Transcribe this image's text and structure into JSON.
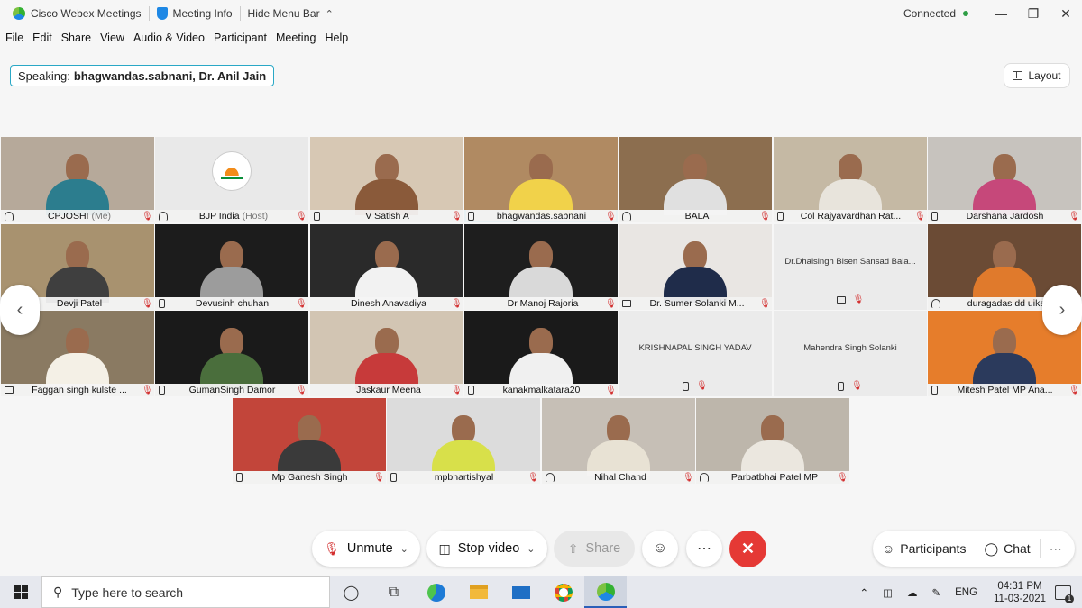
{
  "titlebar": {
    "app_name": "Cisco Webex Meetings",
    "meeting_info": "Meeting Info",
    "hide_menu": "Hide Menu Bar",
    "status": "Connected"
  },
  "menu": [
    "File",
    "Edit",
    "Share",
    "View",
    "Audio & Video",
    "Participant",
    "Meeting",
    "Help"
  ],
  "speaking": {
    "label": "Speaking:",
    "names": "bhagwandas.sabnani, Dr. Anil Jain"
  },
  "layout_label": "Layout",
  "tiles": [
    {
      "name": "CPJOSHI",
      "suffix": "(Me)",
      "device": "audio",
      "bg": "#b6a99a",
      "shirt": "#2c7d8e"
    },
    {
      "name": "BJP India",
      "suffix": "(Host)",
      "device": "audio",
      "bg": "#e9e9e9",
      "logo": true
    },
    {
      "name": "V Satish A",
      "suffix": "",
      "device": "phone",
      "bg": "#d7c8b4",
      "shirt": "#8a5a3a"
    },
    {
      "name": "bhagwandas.sabnani",
      "suffix": "",
      "device": "phone",
      "bg": "#b08a62",
      "shirt": "#f1d24a"
    },
    {
      "name": "BALA",
      "suffix": "",
      "device": "audio",
      "bg": "#8c6e4f",
      "shirt": "#e0e0e0"
    },
    {
      "name": "Col Rajyavardhan Rat...",
      "suffix": "",
      "device": "phone",
      "bg": "#c5b9a4",
      "shirt": "#e8e4dc"
    },
    {
      "name": "Darshana Jardosh",
      "suffix": "",
      "device": "phone",
      "bg": "#c7c3be",
      "shirt": "#c6487a"
    },
    {
      "name": "Devji Patel",
      "suffix": "",
      "device": "none",
      "bg": "#a8926f",
      "shirt": "#3f3f3f"
    },
    {
      "name": "Devusinh chuhan",
      "suffix": "",
      "device": "phone",
      "bg": "#1c1c1c",
      "shirt": "#9c9c9c"
    },
    {
      "name": "Dinesh Anavadiya",
      "suffix": "",
      "device": "none",
      "bg": "#2a2a2a",
      "shirt": "#f2f2f2"
    },
    {
      "name": "Dr Manoj Rajoria",
      "suffix": "",
      "device": "none",
      "bg": "#1e1e1e",
      "shirt": "#d9d9d9"
    },
    {
      "name": "Dr. Sumer Solanki M...",
      "suffix": "",
      "device": "pc",
      "bg": "#e9e6e3",
      "shirt": "#1f2c4a"
    },
    {
      "name": "Dr.Dhalsingh Bisen Sansad Bala...",
      "suffix": "",
      "device": "pc",
      "blank": true
    },
    {
      "name": "duragadas dd uike",
      "suffix": "",
      "device": "audio",
      "bg": "#6b4b35",
      "shirt": "#e07a2c"
    },
    {
      "name": "Faggan singh kulste ...",
      "suffix": "",
      "device": "pc",
      "bg": "#8a7a62",
      "shirt": "#f4f0e6"
    },
    {
      "name": "GumanSingh Damor",
      "suffix": "",
      "device": "phone",
      "bg": "#1a1a1a",
      "shirt": "#4a6e3c"
    },
    {
      "name": "Jaskaur Meena",
      "suffix": "",
      "device": "none",
      "bg": "#d2c5b3",
      "shirt": "#c73a3a"
    },
    {
      "name": "kanakmalkatara20",
      "suffix": "",
      "device": "phone",
      "bg": "#1a1a1a",
      "shirt": "#f0f0f0"
    },
    {
      "name": "KRISHNAPAL SINGH YADAV",
      "suffix": "",
      "device": "phone",
      "blank": true
    },
    {
      "name": "Mahendra Singh Solanki",
      "suffix": "",
      "device": "phone",
      "blank": true
    },
    {
      "name": "Mitesh Patel MP Ana...",
      "suffix": "",
      "device": "phone",
      "bg": "#e67d2b",
      "shirt": "#2b3a5c"
    },
    {
      "name": "Mp Ganesh Singh",
      "suffix": "",
      "device": "phone",
      "bg": "#c2453a",
      "shirt": "#3a3a3a"
    },
    {
      "name": "mpbhartishyal",
      "suffix": "",
      "device": "phone",
      "bg": "#dcdcdc",
      "shirt": "#d8e04a"
    },
    {
      "name": "Nihal Chand",
      "suffix": "",
      "device": "audio",
      "bg": "#c6bfb6",
      "shirt": "#e8e2d4"
    },
    {
      "name": "Parbatbhai Patel MP",
      "suffix": "",
      "device": "audio",
      "bg": "#bdb6ab",
      "shirt": "#ebe7df"
    }
  ],
  "controls": {
    "unmute": "Unmute",
    "stop_video": "Stop video",
    "share": "Share",
    "participants": "Participants",
    "chat": "Chat"
  },
  "taskbar": {
    "search_placeholder": "Type here to search",
    "lang": "ENG",
    "time": "04:31 PM",
    "date": "11-03-2021"
  }
}
